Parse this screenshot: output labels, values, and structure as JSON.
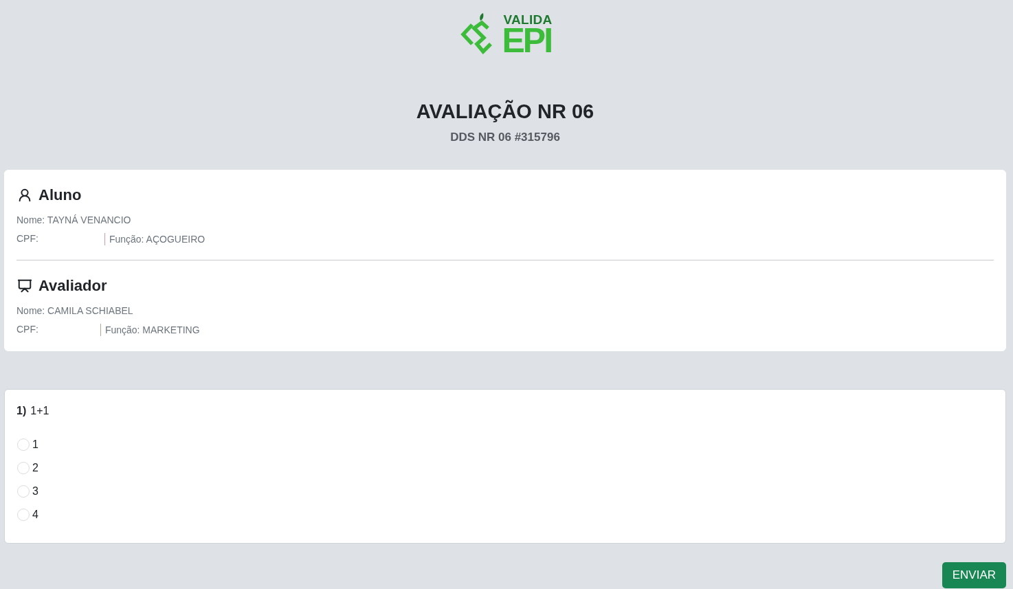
{
  "logo": {
    "line_1": "VALIDA",
    "line_2": "EPI"
  },
  "header": {
    "title": "AVALIAÇÃO NR 06",
    "subtitle": "DDS NR 06 #315796"
  },
  "people": [
    {
      "kind": "student",
      "heading": "Aluno",
      "name_line": "Nome: TAYNÁ VENANCIO",
      "cpf_label": "CPF:",
      "role_line": "Função: AÇOGUEIRO"
    },
    {
      "kind": "evaluator",
      "heading": "Avaliador",
      "name_line": "Nome: CAMILA SCHIABEL",
      "cpf_label": "CPF:",
      "role_line": "Função: MARKETING"
    }
  ],
  "questions": [
    {
      "number": "1)",
      "text": "1+1",
      "options": [
        {
          "label": "1",
          "selected": false
        },
        {
          "label": "2",
          "selected": false
        },
        {
          "label": "3",
          "selected": false
        },
        {
          "label": "4",
          "selected": false
        }
      ]
    }
  ],
  "submit_button": "ENVIAR"
}
